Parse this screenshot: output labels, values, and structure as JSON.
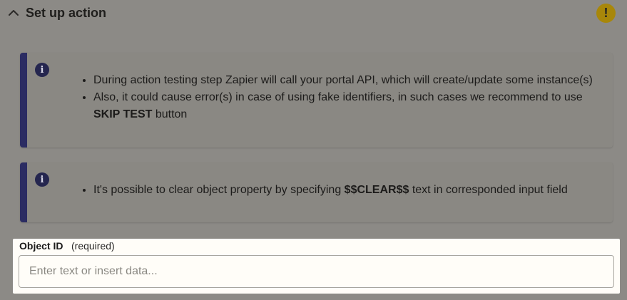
{
  "header": {
    "title": "Set up action",
    "warning_glyph": "!"
  },
  "callouts": [
    {
      "icon": "i",
      "items": [
        "During action testing step Zapier will call your portal API, which will create/update some instance(s)",
        {
          "before": "Also, it could cause error(s) in case of using fake identifiers, in such cases we recommend to use ",
          "bold": "SKIP TEST",
          "after": " button"
        }
      ]
    },
    {
      "icon": "i",
      "items": [
        {
          "before": "It's possible to clear object property by specifying ",
          "bold": "$$CLEAR$$",
          "after": " text in corresponded input field"
        }
      ]
    }
  ],
  "field": {
    "label": "Object ID",
    "required_note": "(required)",
    "placeholder": "Enter text or insert data...",
    "value": ""
  },
  "colors": {
    "accent_bar": "#2b2c62",
    "warning": "#a8870a",
    "info_icon": "#25264f"
  }
}
